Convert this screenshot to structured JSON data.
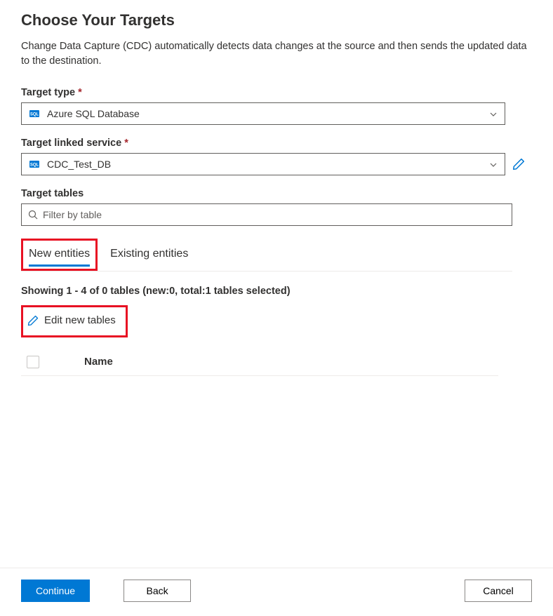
{
  "header": {
    "title": "Choose Your Targets",
    "description": "Change Data Capture (CDC) automatically detects data changes at the source and then sends the updated data to the destination."
  },
  "fields": {
    "target_type": {
      "label": "Target type",
      "required": "*",
      "value": "Azure SQL Database"
    },
    "target_linked_service": {
      "label": "Target linked service",
      "required": "*",
      "value": "CDC_Test_DB"
    },
    "target_tables": {
      "label": "Target tables",
      "placeholder": "Filter by table"
    }
  },
  "tabs": {
    "new_entities": "New entities",
    "existing_entities": "Existing entities"
  },
  "status": {
    "showing_text": "Showing 1 - 4 of 0 tables (new:0, total:1 tables selected)"
  },
  "actions": {
    "edit_new_tables": "Edit new tables"
  },
  "table": {
    "columns": {
      "name": "Name"
    }
  },
  "footer": {
    "continue": "Continue",
    "back": "Back",
    "cancel": "Cancel"
  }
}
